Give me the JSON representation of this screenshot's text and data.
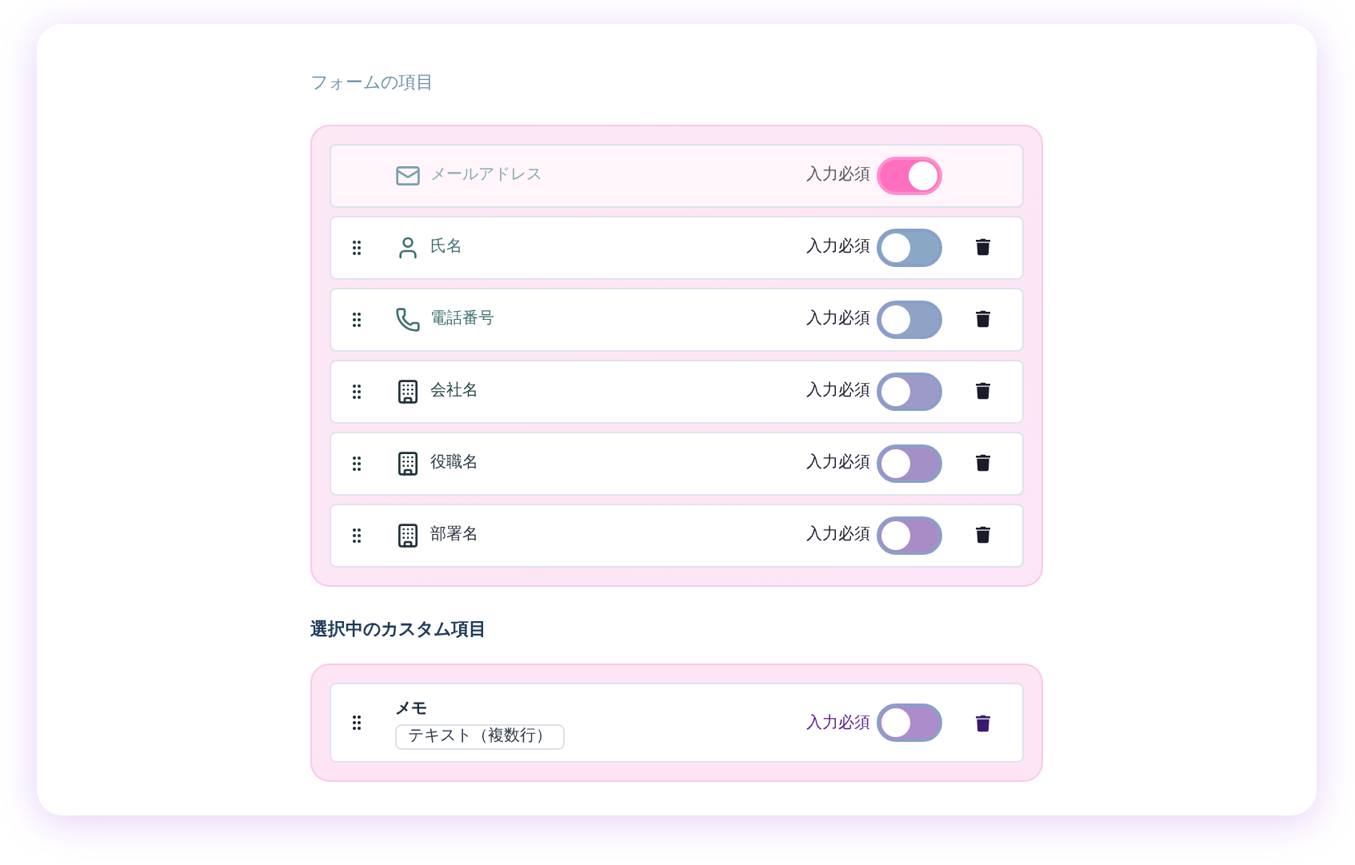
{
  "form_fields": {
    "title": "フォームの項目",
    "items": [
      {
        "kind": "mail",
        "label": "メールアドレス",
        "required_label": "入力必須",
        "required": true,
        "locked": true
      },
      {
        "kind": "person",
        "label": "氏名",
        "required_label": "入力必須",
        "required": false,
        "locked": false
      },
      {
        "kind": "phone",
        "label": "電話番号",
        "required_label": "入力必須",
        "required": false,
        "locked": false
      },
      {
        "kind": "building",
        "label": "会社名",
        "required_label": "入力必須",
        "required": false,
        "locked": false
      },
      {
        "kind": "building",
        "label": "役職名",
        "required_label": "入力必須",
        "required": false,
        "locked": false
      },
      {
        "kind": "building",
        "label": "部署名",
        "required_label": "入力必須",
        "required": false,
        "locked": false
      }
    ]
  },
  "custom_fields": {
    "title": "選択中のカスタム項目",
    "items": [
      {
        "label": "メモ",
        "type_badge": "テキスト（複数行）",
        "required_label": "入力必須",
        "required": false
      }
    ]
  }
}
